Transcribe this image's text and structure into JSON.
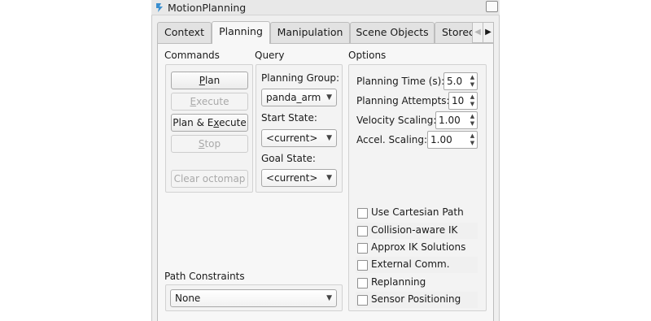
{
  "window": {
    "title": "MotionPlanning"
  },
  "tabs": [
    {
      "label": "Context"
    },
    {
      "label": "Planning"
    },
    {
      "label": "Manipulation"
    },
    {
      "label": "Scene Objects"
    },
    {
      "label": "Storec"
    }
  ],
  "commands": {
    "title": "Commands",
    "plan_u": "P",
    "plan_rest": "lan",
    "execute_u": "E",
    "execute_rest": "xecute",
    "plan_execute_pre": "Plan & E",
    "plan_execute_u": "x",
    "plan_execute_rest": "ecute",
    "stop_u": "S",
    "stop_rest": "top",
    "clear_octomap": "Clear octomap"
  },
  "query": {
    "title": "Query",
    "planning_group_label": "Planning Group:",
    "planning_group_value": "panda_arm",
    "start_state_label": "Start State:",
    "start_state_value": "<current>",
    "goal_state_label": "Goal State:",
    "goal_state_value": "<current>"
  },
  "options": {
    "title": "Options",
    "planning_time_label": "Planning Time (s):",
    "planning_time_value": "5.0",
    "planning_attempts_label": "Planning Attempts:",
    "planning_attempts_value": "10",
    "velocity_scaling_label": "Velocity Scaling:",
    "velocity_scaling_value": "1.00",
    "accel_scaling_label": "Accel. Scaling:",
    "accel_scaling_value": "1.00",
    "checkboxes": [
      {
        "label": "Use Cartesian Path",
        "checked": false
      },
      {
        "label": "Collision-aware IK",
        "checked": false
      },
      {
        "label": "Approx IK Solutions",
        "checked": false
      },
      {
        "label": "External Comm.",
        "checked": false
      },
      {
        "label": "Replanning",
        "checked": false
      },
      {
        "label": "Sensor Positioning",
        "checked": false
      }
    ]
  },
  "path_constraints": {
    "title": "Path Constraints",
    "value": "None"
  }
}
